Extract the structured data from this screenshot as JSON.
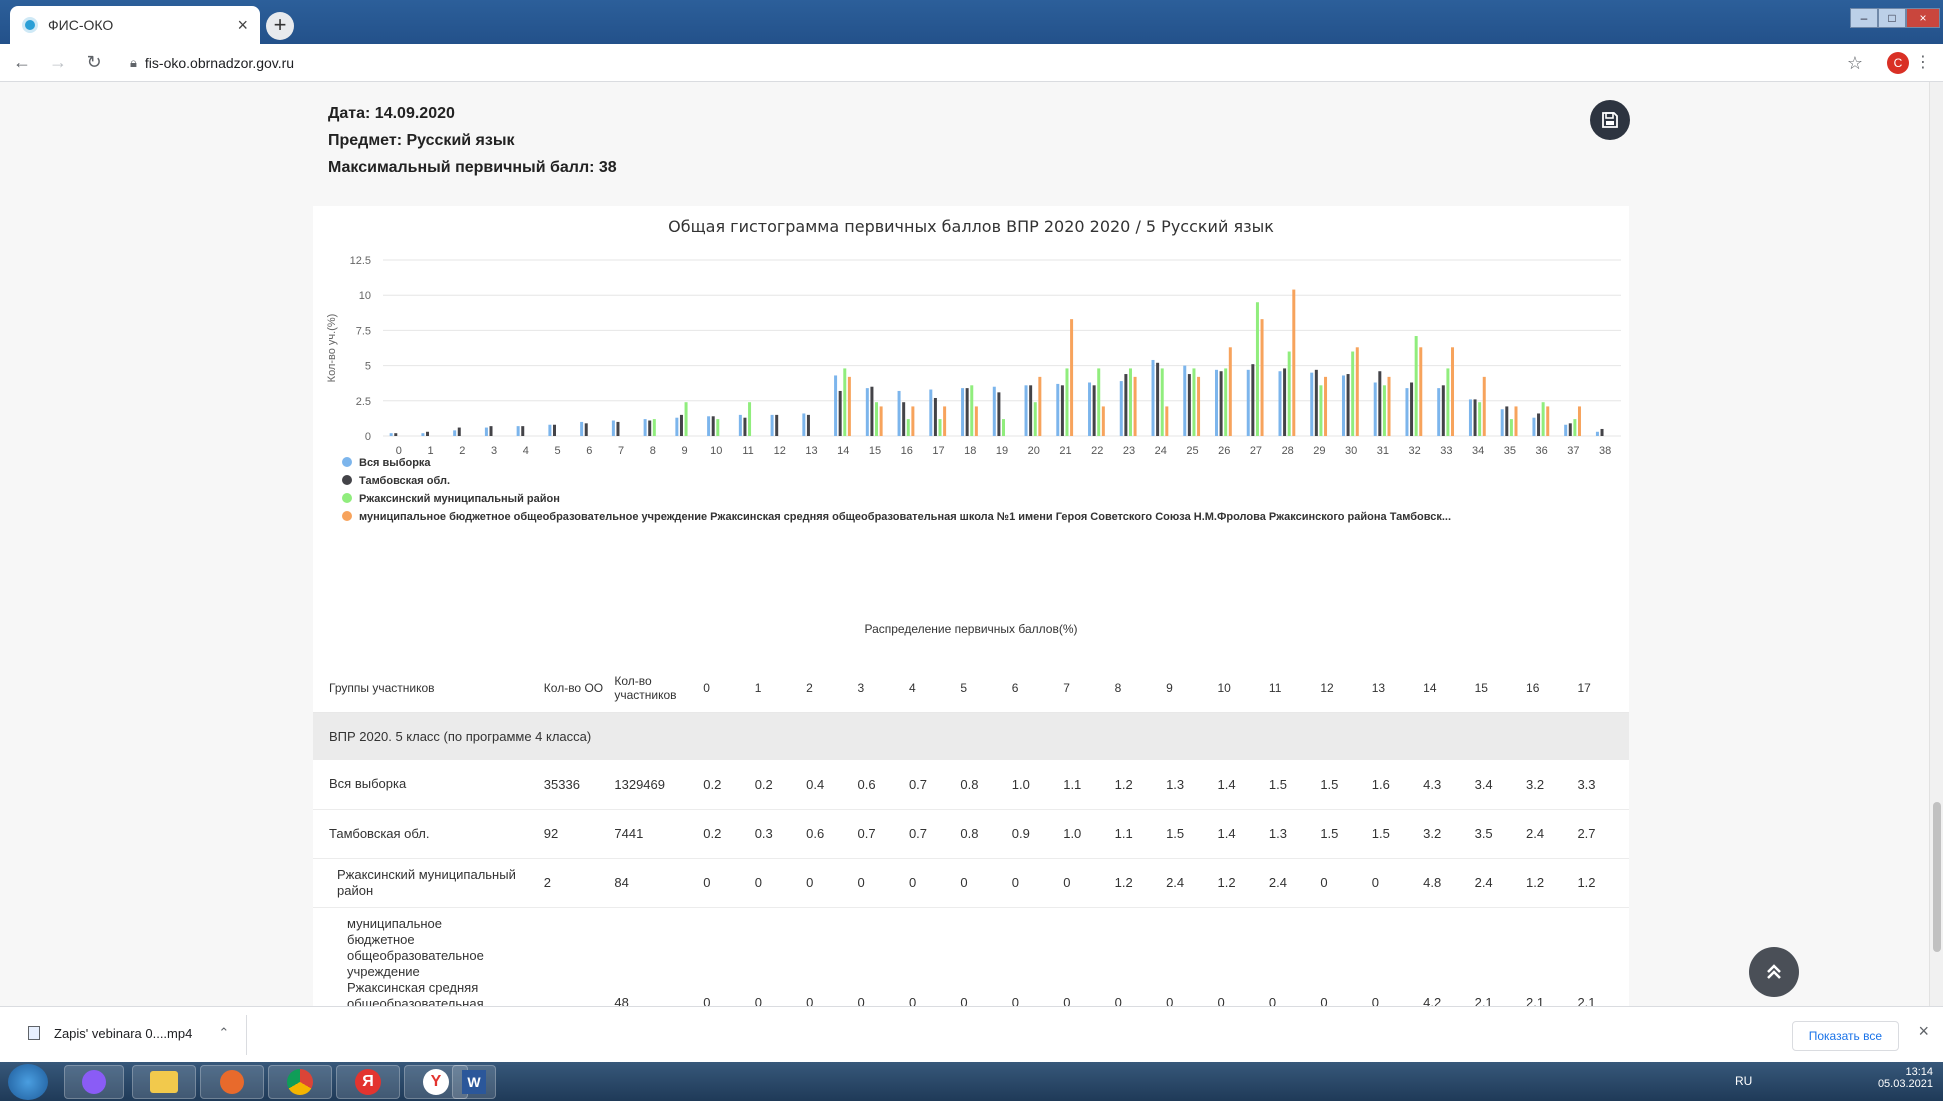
{
  "browser": {
    "tab_title": "ФИС-ОКО",
    "new_tab_symbol": "+",
    "url": "fis-oko.obrnadzor.gov.ru",
    "profile_initial": "C"
  },
  "header": {
    "date_line": "Дата: 14.09.2020",
    "subject_line": "Предмет: Русский язык",
    "max_score_line": "Максимальный первичный балл: 38"
  },
  "chart_data": {
    "type": "bar",
    "title": "Общая гистограмма первичных баллов ВПР 2020 2020 / 5 Русский язык",
    "xlabel": "",
    "ylabel": "Кол-во уч.(%)",
    "ylim": [
      0,
      12.5
    ],
    "yticks": [
      "0",
      "2.5",
      "5",
      "7.5",
      "10",
      "12.5"
    ],
    "grid": true,
    "legend_position": "bottom-left",
    "categories": [
      "0",
      "1",
      "2",
      "3",
      "4",
      "5",
      "6",
      "7",
      "8",
      "9",
      "10",
      "11",
      "12",
      "13",
      "14",
      "15",
      "16",
      "17",
      "18",
      "19",
      "20",
      "21",
      "22",
      "23",
      "24",
      "25",
      "26",
      "27",
      "28",
      "29",
      "30",
      "31",
      "32",
      "33",
      "34",
      "35",
      "36",
      "37",
      "38"
    ],
    "series": [
      {
        "name": "Вся выборка",
        "color": "#7cb5ec",
        "values": [
          0.2,
          0.2,
          0.4,
          0.6,
          0.7,
          0.8,
          1.0,
          1.1,
          1.2,
          1.3,
          1.4,
          1.5,
          1.5,
          1.6,
          4.3,
          3.4,
          3.2,
          3.3,
          3.4,
          3.5,
          3.6,
          3.7,
          3.8,
          3.9,
          5.4,
          5.0,
          4.7,
          4.7,
          4.6,
          4.5,
          4.3,
          3.8,
          3.4,
          3.4,
          2.6,
          1.9,
          1.3,
          0.8,
          0.3
        ]
      },
      {
        "name": "Тамбовская обл.",
        "color": "#434348",
        "values": [
          0.2,
          0.3,
          0.6,
          0.7,
          0.7,
          0.8,
          0.9,
          1.0,
          1.1,
          1.5,
          1.4,
          1.3,
          1.5,
          1.5,
          3.2,
          3.5,
          2.4,
          2.7,
          3.4,
          3.1,
          3.6,
          3.6,
          3.6,
          4.4,
          5.2,
          4.4,
          4.6,
          5.1,
          4.8,
          4.7,
          4.4,
          4.6,
          3.8,
          3.6,
          2.6,
          2.1,
          1.6,
          0.9,
          0.5
        ]
      },
      {
        "name": "Ржаксинский муниципальный район",
        "color": "#90ed7d",
        "values": [
          0,
          0,
          0,
          0,
          0,
          0,
          0,
          0,
          1.2,
          2.4,
          1.2,
          2.4,
          0,
          0,
          4.8,
          2.4,
          1.2,
          1.2,
          3.6,
          1.2,
          2.4,
          4.8,
          4.8,
          4.8,
          4.8,
          4.8,
          4.8,
          9.5,
          6.0,
          3.6,
          6.0,
          3.6,
          7.1,
          4.8,
          2.4,
          1.2,
          2.4,
          1.2,
          0
        ]
      },
      {
        "name": "муниципальное бюджетное общеобразовательное учреждение Ржаксинская средняя общеобразовательная школа №1 имени Героя Советского Союза Н.М.Фролова Ржаксинского района Тамбовск...",
        "color": "#f7a35c",
        "values": [
          0,
          0,
          0,
          0,
          0,
          0,
          0,
          0,
          0,
          0,
          0,
          0,
          0,
          0,
          4.2,
          2.1,
          2.1,
          2.1,
          2.1,
          0,
          4.2,
          8.3,
          2.1,
          4.2,
          2.1,
          4.2,
          6.3,
          8.3,
          10.4,
          4.2,
          6.3,
          4.2,
          6.3,
          6.3,
          4.2,
          2.1,
          2.1,
          2.1,
          0
        ]
      }
    ]
  },
  "table": {
    "title": "Распределение первичных баллов(%)",
    "headers": {
      "group": "Группы участников",
      "oo": "Кол-во ОО",
      "participants": "Кол-во участников",
      "scores": [
        "0",
        "1",
        "2",
        "3",
        "4",
        "5",
        "6",
        "7",
        "8",
        "9",
        "10",
        "11",
        "12",
        "13",
        "14",
        "15",
        "16",
        "17"
      ]
    },
    "group_row": "ВПР 2020. 5 класс (по программе 4 класса)",
    "rows": [
      {
        "name": "Вся выборка",
        "oo": "35336",
        "participants": "1329469",
        "values": [
          "0.2",
          "0.2",
          "0.4",
          "0.6",
          "0.7",
          "0.8",
          "1.0",
          "1.1",
          "1.2",
          "1.3",
          "1.4",
          "1.5",
          "1.5",
          "1.6",
          "4.3",
          "3.4",
          "3.2",
          "3.3"
        ]
      },
      {
        "name": "Тамбовская обл.",
        "oo": "92",
        "participants": "7441",
        "values": [
          "0.2",
          "0.3",
          "0.6",
          "0.7",
          "0.7",
          "0.8",
          "0.9",
          "1.0",
          "1.1",
          "1.5",
          "1.4",
          "1.3",
          "1.5",
          "1.5",
          "3.2",
          "3.5",
          "2.4",
          "2.7"
        ]
      },
      {
        "name": "Ржаксинский муниципальный район",
        "oo": "2",
        "participants": "84",
        "values": [
          "0",
          "0",
          "0",
          "0",
          "0",
          "0",
          "0",
          "0",
          "1.2",
          "2.4",
          "1.2",
          "2.4",
          "0",
          "0",
          "4.8",
          "2.4",
          "1.2",
          "1.2"
        ]
      },
      {
        "name": "муниципальное бюджетное общеобразовательное учреждение Ржаксинская средняя общеобразовательная",
        "oo": "",
        "participants": "48",
        "values": [
          "0",
          "0",
          "0",
          "0",
          "0",
          "0",
          "0",
          "0",
          "0",
          "0",
          "0",
          "0",
          "0",
          "0",
          "4.2",
          "2.1",
          "2.1",
          "2.1"
        ]
      }
    ]
  },
  "downloads": {
    "file_name": "Zapis' vebinara 0....mp4",
    "show_all": "Показать все"
  },
  "taskbar": {
    "lang": "RU",
    "time": "13:14",
    "date": "05.03.2021"
  }
}
